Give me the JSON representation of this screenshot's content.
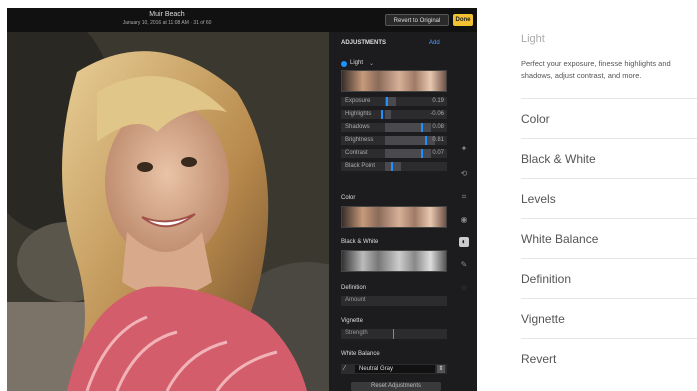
{
  "header": {
    "title": "Muir Beach",
    "subtitle": "January 10, 2016 at 11:08 AM  ·  31 of 60",
    "revert_label": "Revert to Original",
    "done_label": "Done"
  },
  "panel": {
    "title": "ADJUSTMENTS",
    "add_label": "Add",
    "light_section": {
      "label": "Light",
      "sliders": [
        {
          "label": "Exposure",
          "value": "0.19"
        },
        {
          "label": "Highlights",
          "value": "-0.06"
        },
        {
          "label": "Shadows",
          "value": "0.08"
        },
        {
          "label": "Brightness",
          "value": "0.81"
        },
        {
          "label": "Contrast",
          "value": "0.07"
        },
        {
          "label": "Black Point",
          "value": ""
        }
      ]
    },
    "color_section": {
      "label": "Color"
    },
    "bw_section": {
      "label": "Black & White"
    },
    "definition_section": {
      "label": "Definition",
      "row_label": "Amount"
    },
    "vignette_section": {
      "label": "Vignette",
      "row_label": "Strength"
    },
    "white_balance": {
      "label": "White Balance",
      "selected": "Neutral Gray"
    },
    "reset_label": "Reset Adjustments"
  },
  "sidebar": {
    "heading": "Light",
    "description": "Perfect your exposure, finesse highlights and shadows, adjust contrast, and more.",
    "items": [
      "Color",
      "Black & White",
      "Levels",
      "White Balance",
      "Definition",
      "Vignette",
      "Revert"
    ]
  },
  "colors": {
    "accent": "#1e90ff",
    "done_button": "#f2c230",
    "app_background": "#1c1c1e"
  }
}
